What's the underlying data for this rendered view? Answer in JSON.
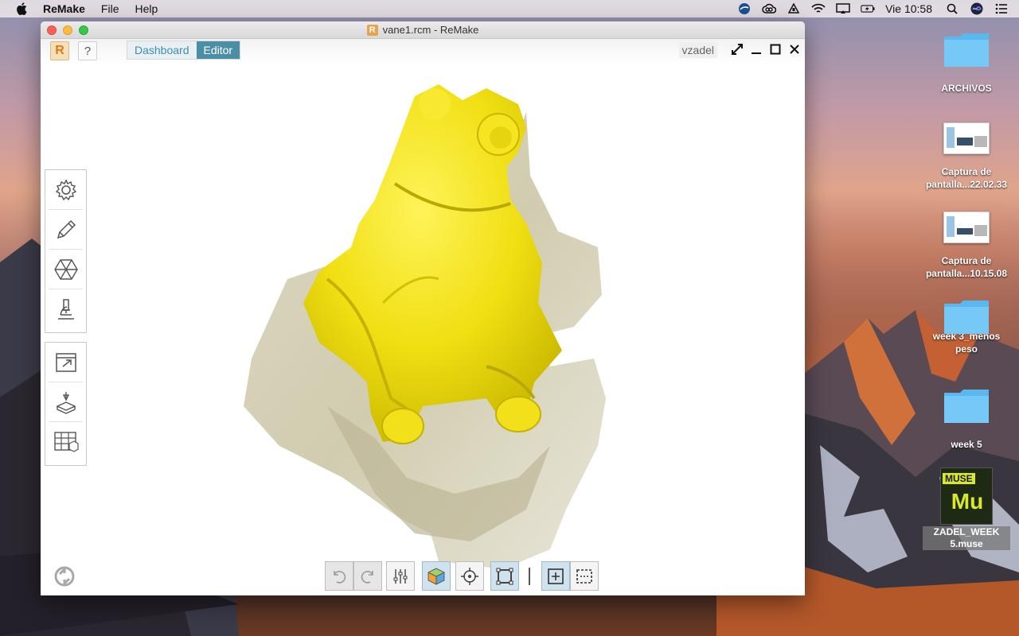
{
  "menubar": {
    "apple_icon": "apple-icon",
    "app_name": "ReMake",
    "menus": [
      "File",
      "Help"
    ],
    "clock": "Vie 10:58",
    "status_icons": [
      "app-status-icon",
      "creative-cloud-icon",
      "drive-icon",
      "wifi-icon",
      "airplay-icon",
      "battery-icon",
      "search-icon",
      "siri-icon",
      "notification-center-icon"
    ]
  },
  "window": {
    "title": "vane1.rcm - ReMake",
    "title_logo": "R",
    "toolbar": {
      "r_button": "R",
      "help_button": "?",
      "tabs": [
        "Dashboard",
        "Editor"
      ],
      "active_tab": "Editor",
      "user": "vzadel"
    },
    "window_controls": [
      "expand-icon",
      "minimize-icon",
      "maximize-icon",
      "close-icon"
    ],
    "left_tools": {
      "group1": [
        "settings-icon",
        "pencil-icon",
        "mesh-icon",
        "microscope-icon"
      ],
      "group2": [
        "export-icon",
        "print-3d-icon",
        "grid-table-icon"
      ]
    },
    "bottom_toolbar": [
      "undo-icon",
      "redo-icon",
      "sliders-icon",
      "cube-icon",
      "crosshair-icon",
      "frame-icon",
      "fit-selection-icon",
      "select-rect-icon"
    ]
  },
  "desktop": {
    "items": [
      {
        "label": "ARCHIVOS",
        "type": "folder"
      },
      {
        "label": "Captura de pantalla...22.02.33",
        "type": "screenshot"
      },
      {
        "label": "Captura de pantalla...10.15.08",
        "type": "screenshot"
      },
      {
        "label": "week 3_menos peso",
        "type": "folder"
      },
      {
        "label": "week 5",
        "type": "folder"
      },
      {
        "label": "ZADEL_WEEK 5.muse",
        "type": "muse"
      }
    ],
    "muse_badge": "MUSE",
    "muse_glyph": "Mu"
  },
  "colors": {
    "accent": "#4b8fa6",
    "model_yellow": "#f2e21a",
    "base_gray": "#d8d4c0"
  }
}
